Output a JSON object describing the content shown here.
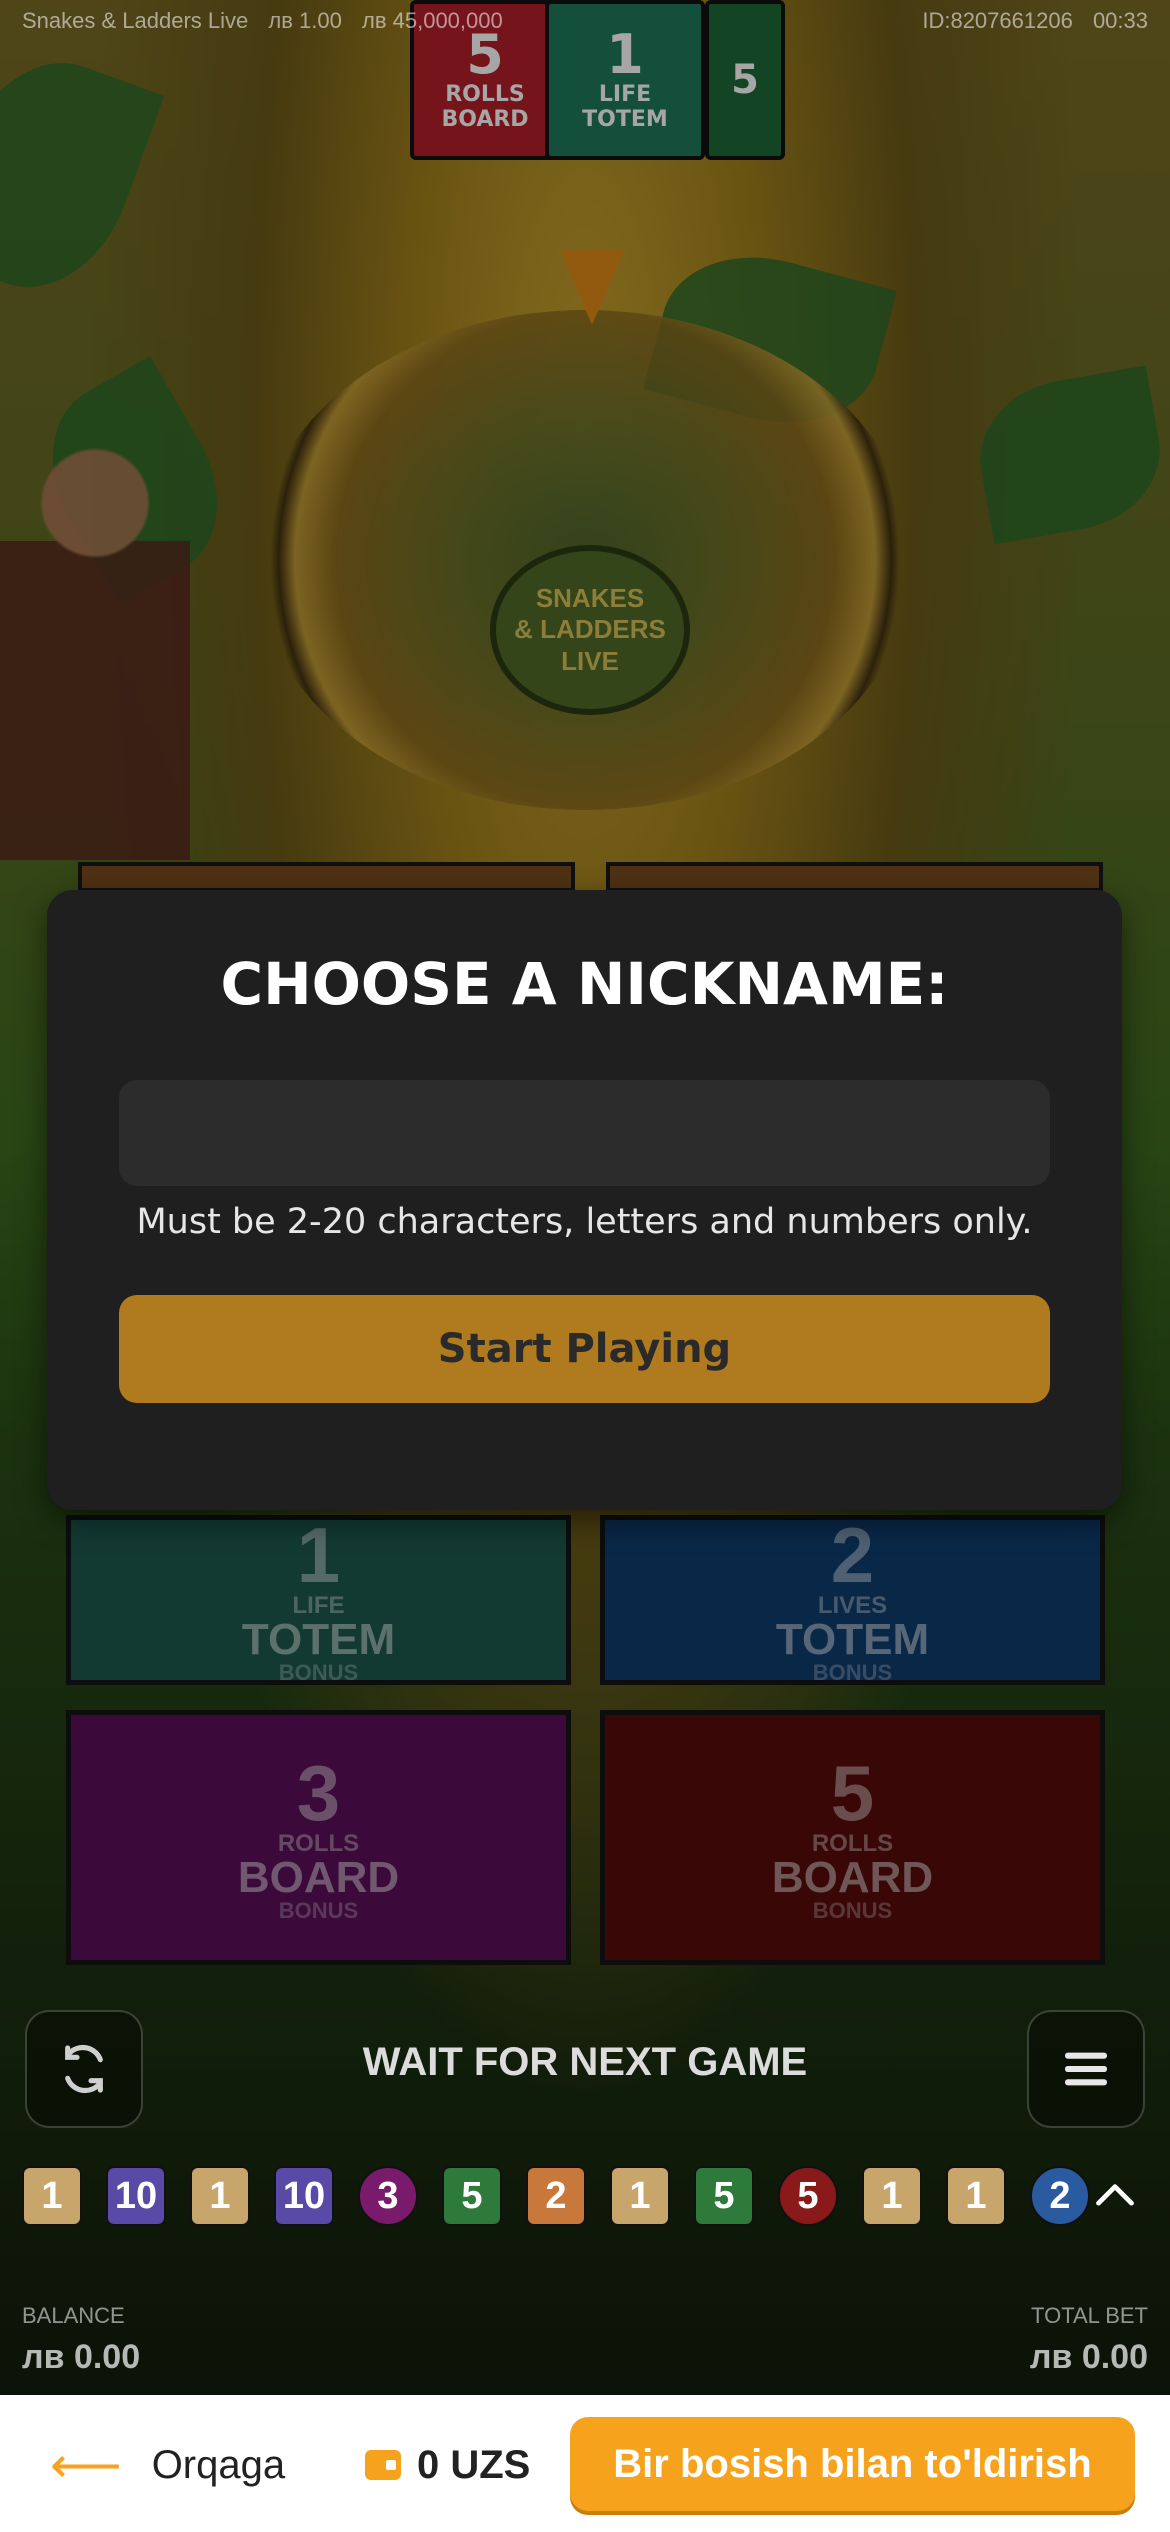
{
  "top_info": {
    "game_name": "Snakes & Ladders Live",
    "min_bet": "лв 1.00",
    "max_bet": "лв 45,000,000",
    "id": "ID:8207661206",
    "time": "00:33"
  },
  "banners": [
    {
      "number": "5",
      "line1": "ROLLS",
      "line2": "BOARD",
      "color": "#b5202a"
    },
    {
      "number": "1",
      "line1": "LIFE",
      "line2": "TOTEM",
      "color": "#1e7a5a"
    },
    {
      "number": "5",
      "line1": "",
      "line2": "",
      "color": "#1e6a3a"
    }
  ],
  "wheel": {
    "center_lines": [
      "SNAKES",
      "& LADDERS",
      "LIVE"
    ]
  },
  "modal": {
    "title": "CHOOSE A NICKNAME:",
    "input_value": "",
    "input_placeholder": "",
    "hint": "Must be 2-20 characters, letters and numbers only.",
    "start_label": "Start Playing"
  },
  "tiles": [
    {
      "num": "1",
      "sub": "LIFE",
      "word": "TOTEM",
      "bonus": "BONUS",
      "color": "green"
    },
    {
      "num": "2",
      "sub": "LIVES",
      "word": "TOTEM",
      "bonus": "BONUS",
      "color": "blue"
    },
    {
      "num": "3",
      "sub": "ROLLS",
      "word": "BOARD",
      "bonus": "BONUS",
      "color": "purple"
    },
    {
      "num": "5",
      "sub": "ROLLS",
      "word": "BOARD",
      "bonus": "BONUS",
      "color": "red"
    }
  ],
  "controls": {
    "wait_label": "WAIT FOR NEXT GAME",
    "refresh_icon": "refresh-icon",
    "menu_icon": "menu-icon"
  },
  "history": [
    {
      "value": "1",
      "color": "#c8a56a",
      "shape": "square"
    },
    {
      "value": "10",
      "color": "#5a4aa8",
      "shape": "square"
    },
    {
      "value": "1",
      "color": "#c8a56a",
      "shape": "square"
    },
    {
      "value": "10",
      "color": "#5a4aa8",
      "shape": "square"
    },
    {
      "value": "3",
      "color": "#7a1a6a",
      "shape": "round"
    },
    {
      "value": "5",
      "color": "#2e7a3a",
      "shape": "square"
    },
    {
      "value": "2",
      "color": "#c8783a",
      "shape": "square"
    },
    {
      "value": "1",
      "color": "#c8a56a",
      "shape": "square"
    },
    {
      "value": "5",
      "color": "#2e7a3a",
      "shape": "square"
    },
    {
      "value": "5",
      "color": "#8a1a1a",
      "shape": "round"
    },
    {
      "value": "1",
      "color": "#c8a56a",
      "shape": "square"
    },
    {
      "value": "1",
      "color": "#c8a56a",
      "shape": "square"
    },
    {
      "value": "2",
      "color": "#2a5aa0",
      "shape": "round"
    }
  ],
  "balance": {
    "label": "BALANCE",
    "value": "лв 0.00"
  },
  "total_bet": {
    "label": "TOTAL BET",
    "value": "лв 0.00"
  },
  "bottom_bar": {
    "back_label": "Orqaga",
    "wallet_value": "0 UZS",
    "topup_label": "Bir bosish bilan to'ldirish",
    "accent_color": "#f7a21c"
  }
}
